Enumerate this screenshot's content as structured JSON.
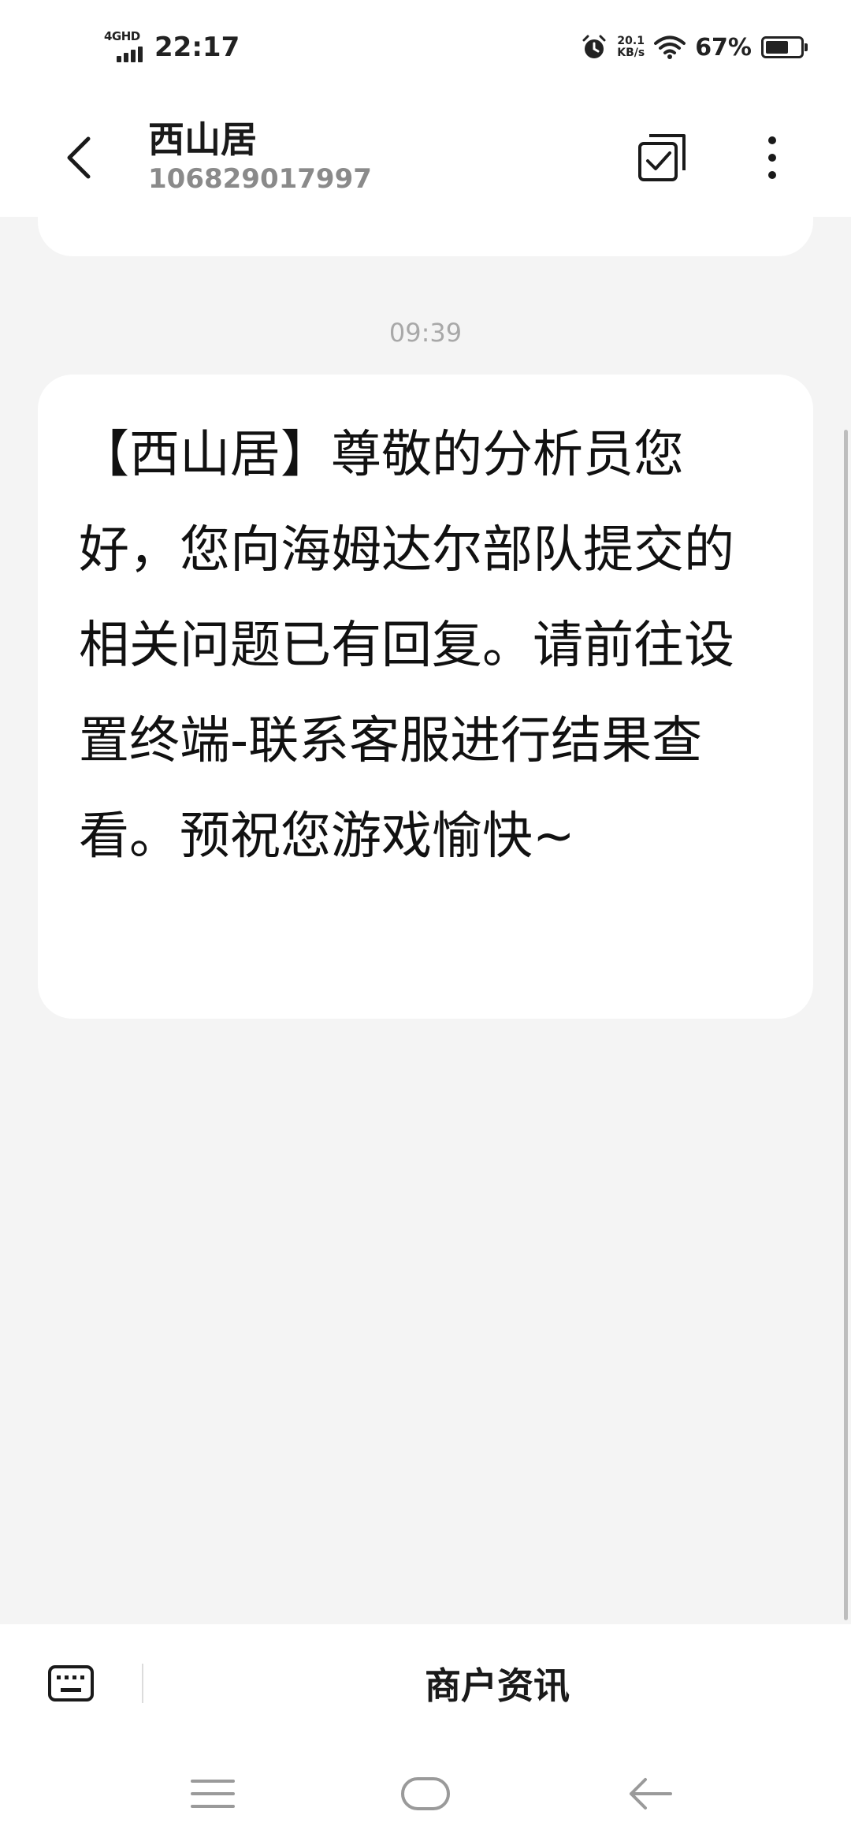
{
  "status_bar": {
    "network": "4GHD",
    "time": "22:17",
    "speed_value": "20.1",
    "speed_unit": "KB/s",
    "battery_pct": "67%",
    "battery_level": 0.67,
    "icons": [
      "signal-icon",
      "alarm-icon",
      "wifi-icon",
      "battery-icon"
    ]
  },
  "header": {
    "title": "西山居",
    "subtitle": "106829017997",
    "icons": [
      "back-arrow-icon",
      "multi-select-icon",
      "more-vert-icon"
    ]
  },
  "conversation": {
    "timestamp": "09:39",
    "message": "【西山居】尊敬的分析员您好，您向海姆达尔部队提交的相关问题已有回复。请前往设置终端-联系客服进行结果查看。预祝您游戏愉快~"
  },
  "bottom_menu": {
    "menu_label": "商户资讯",
    "icons": [
      "keyboard-icon"
    ]
  },
  "nav_bar": {
    "icons": [
      "menu-icon",
      "home-icon",
      "back-icon"
    ]
  },
  "colors": {
    "background": "#f4f4f4",
    "surface": "#ffffff",
    "text_primary": "#1a1a1a",
    "text_secondary": "#8a8a8a",
    "timestamp": "#a8a8a8"
  }
}
